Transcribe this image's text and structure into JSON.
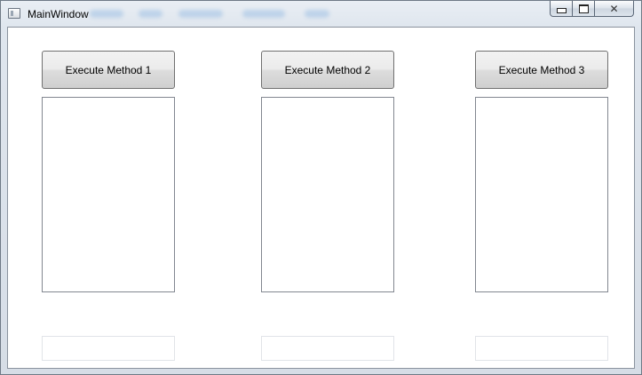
{
  "window": {
    "title": "MainWindow",
    "controls": {
      "minimize": "minimize",
      "maximize": "maximize",
      "close": "✕"
    }
  },
  "columns": [
    {
      "button_label": "Execute Method 1",
      "list_items": [],
      "text_value": ""
    },
    {
      "button_label": "Execute Method 2",
      "list_items": [],
      "text_value": ""
    },
    {
      "button_label": "Execute Method 3",
      "list_items": [],
      "text_value": ""
    }
  ],
  "icons": {
    "app": "app-window-icon",
    "min": "minimize-icon",
    "max": "maximize-icon",
    "close": "close-icon"
  }
}
